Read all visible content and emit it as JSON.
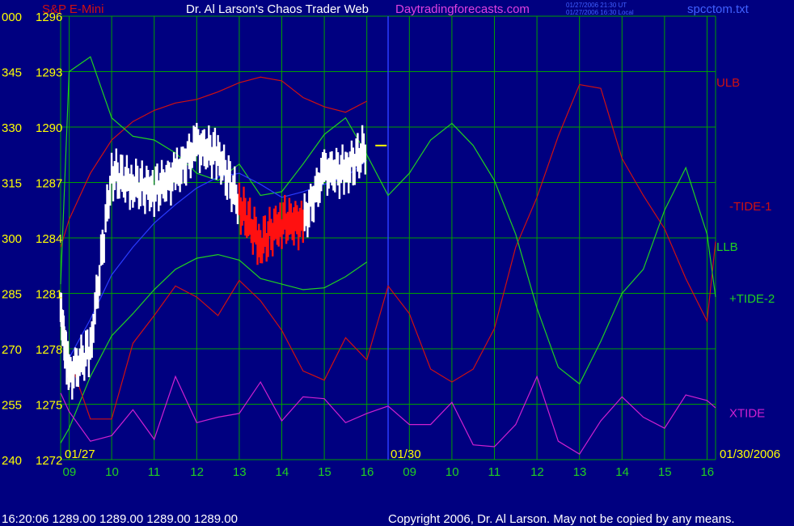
{
  "header": {
    "title_left": "S&P E-Mini",
    "title_center": "Dr. Al Larson's Chaos Trader Web",
    "site": "Daytradingforecasts.com",
    "timestamp_line1": "01/27/2006 21:30 UT",
    "timestamp_line2": "01/27/2006 16:30 Local",
    "filename": "spcctom.txt"
  },
  "footer": {
    "quote": "16:20:06   1289.00  1289.00  1289.00  1289.00",
    "copyright": "Copyright 2006, Dr. Al Larson. May not be copied by any means."
  },
  "dates": {
    "left": "01/27",
    "mid": "01/30",
    "right": "01/30/2006"
  },
  "colors": {
    "background": "#000080",
    "grid": "#00a000",
    "ulb": "#d01010",
    "llb": "#20d020",
    "xtide": "#d020d0",
    "tide_blue": "#2a3cff",
    "price_white": "#ffffff",
    "price_red": "#ff1010",
    "axis_yellow": "#ffff00",
    "axis_white": "#ffffff",
    "time_green": "#20d020"
  },
  "chart_data": {
    "type": "line",
    "title": "S&P E-Mini",
    "ylim": [
      1272,
      1296
    ],
    "y_ticks_right": [
      "1296",
      "1293",
      "1290",
      "1287",
      "1284",
      "1281",
      "1278",
      "1275",
      "1272"
    ],
    "y_ticks_left": [
      "000",
      "345",
      "330",
      "315",
      "300",
      "285",
      "270",
      "255",
      "240"
    ],
    "x_ticks": [
      "09",
      "10",
      "11",
      "12",
      "13",
      "14",
      "15",
      "16",
      "09",
      "10",
      "11",
      "12",
      "13",
      "14",
      "15",
      "16"
    ],
    "x_hours": [
      8.8,
      9,
      9.5,
      10,
      10.5,
      11,
      11.5,
      12,
      12.5,
      13,
      13.5,
      14,
      14.5,
      15,
      15.5,
      16,
      16.5,
      17,
      17.5,
      18,
      18.5,
      19,
      19.5,
      20,
      20.5,
      21,
      21.5,
      22,
      22.5,
      23,
      23.5,
      24,
      24.2
    ],
    "legend": [
      "ULB",
      "-TIDE-1",
      "LLB",
      "+TIDE-2",
      "XTIDE"
    ],
    "series": [
      {
        "name": "ULB",
        "values": [
          1283.5,
          1285,
          1287.5,
          1289.3,
          1290.3,
          1290.9,
          1291.3,
          1291.5,
          1291.9,
          1292.4,
          1292.7,
          1292.5,
          1291.6,
          1291.1,
          1290.8,
          1291.4,
          null,
          null,
          null,
          null,
          null,
          null,
          null,
          null,
          null,
          null,
          null,
          null,
          null,
          null,
          null,
          null,
          null
        ]
      },
      {
        "name": "LLB",
        "values": [
          1272.9,
          1273.7,
          1276.5,
          1278.7,
          1279.9,
          1281.2,
          1282.3,
          1282.9,
          1283.1,
          1282.8,
          1281.8,
          1281.5,
          1281.2,
          1281.3,
          1281.9,
          1282.7,
          null,
          null,
          null,
          null,
          null,
          null,
          null,
          null,
          null,
          null,
          null,
          null,
          null,
          null,
          null,
          null,
          null
        ]
      },
      {
        "name": "-TIDE-1",
        "values": [
          1280.5,
          1277.5,
          1274.2,
          1274.2,
          1278.3,
          1279.8,
          1281.4,
          1280.8,
          1279.8,
          1281.7,
          1280.6,
          1279,
          1276.8,
          1276.3,
          1278.6,
          1277.4,
          1281.4,
          1279.9,
          1276.9,
          1276.2,
          1276.9,
          1279.1,
          1283.5,
          1286.2,
          1289.5,
          1292.3,
          1292.1,
          1288.3,
          1286.3,
          1284.5,
          1281.8,
          1279.5,
          1283.8
        ]
      },
      {
        "name": "+TIDE-2",
        "values": [
          1281.5,
          1293,
          1293.8,
          1290.5,
          1289.5,
          1289.3,
          1288.6,
          1287.5,
          1287.1,
          1288,
          1286.3,
          1286.5,
          1288,
          1289.6,
          1290.5,
          1288.5,
          1286.3,
          1287.5,
          1289.3,
          1290.2,
          1289,
          1287.1,
          1284.2,
          1280.2,
          1277,
          1276.1,
          1278.4,
          1281,
          1282.3,
          1285.5,
          1287.8,
          1284.2,
          1280.8
        ]
      },
      {
        "name": "XTIDE",
        "values": [
          1275.6,
          1274.6,
          1273,
          1273.3,
          1274.7,
          1273.1,
          1276.5,
          1274,
          1274.3,
          1274.5,
          1276.2,
          1274.1,
          1275.4,
          1275.3,
          1274,
          1274.5,
          1274.9,
          1273.9,
          1273.9,
          1275.1,
          1272.8,
          1272.7,
          1273.9,
          1276.5,
          1273,
          1272.3,
          1274.1,
          1275.4,
          1274.3,
          1273.7,
          1275.5,
          1275.2,
          1274.8
        ]
      },
      {
        "name": "Tide",
        "values": [
          null,
          1277.5,
          1279.6,
          1282,
          1283.5,
          1284.8,
          1285.8,
          1286.7,
          1287.3,
          1287.5,
          1286.9,
          1286.2,
          1286.5,
          1286.9,
          1287.3,
          1288.2,
          null,
          null,
          null,
          null,
          null,
          null,
          null,
          null,
          null,
          null,
          null,
          null,
          null,
          null,
          null,
          null,
          null
        ]
      },
      {
        "name": "Price",
        "values": [
          1280,
          1276.5,
          1278,
          1287.5,
          1286.9,
          1286.6,
          1287.4,
          1289,
          1288.5,
          1285.8,
          1283.7,
          1284.9,
          1284.8,
          1287.6,
          1287.6,
          1288.9,
          null,
          null,
          null,
          null,
          null,
          null,
          null,
          null,
          null,
          null,
          null,
          null,
          null,
          null,
          null,
          null,
          null
        ]
      }
    ],
    "down_segment_hours": [
      13,
      14.5
    ],
    "last_price": 1289
  }
}
